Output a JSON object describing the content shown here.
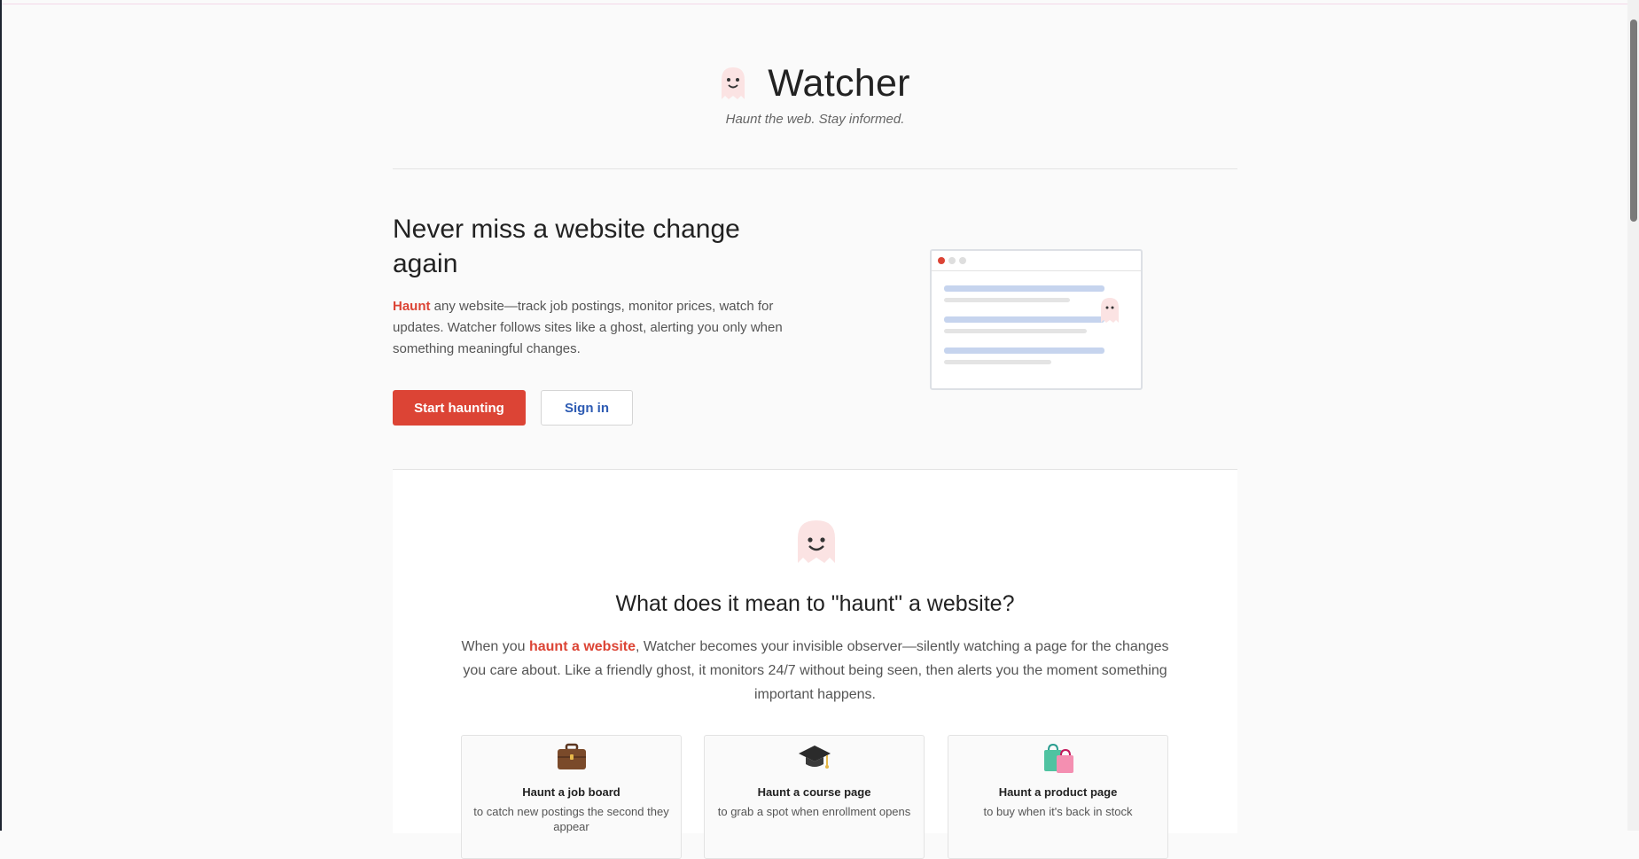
{
  "header": {
    "brand_name": "Watcher",
    "tagline": "Haunt the web. Stay informed.",
    "logo_icon": "ghost-icon"
  },
  "hero": {
    "title": "Never miss a website change again",
    "desc_accent": "Haunt",
    "desc_rest": " any website—track job postings, monitor prices, watch for updates. Watcher follows sites like a ghost, alerting you only when something meaningful changes.",
    "primary_button": "Start haunting",
    "secondary_button": "Sign in",
    "illustration_icon": "browser-window-with-ghost"
  },
  "explainer": {
    "icon": "ghost-icon",
    "title": "What does it mean to \"haunt\" a website?",
    "text_before": "When you ",
    "text_accent": "haunt a website",
    "text_after": ", Watcher becomes your invisible observer—silently watching a page for the changes you care about. Like a friendly ghost, it monitors 24/7 without being seen, then alerts you the moment something important happens.",
    "cards": [
      {
        "icon": "briefcase-icon",
        "glyph": "💼",
        "title": "Haunt a job board",
        "desc": "to catch new postings the second they appear"
      },
      {
        "icon": "graduation-cap-icon",
        "glyph": "🎓",
        "title": "Haunt a course page",
        "desc": "to grab a spot when enrollment opens"
      },
      {
        "icon": "shopping-bags-icon",
        "glyph": "🛍️",
        "title": "Haunt a product page",
        "desc": "to buy when it's back in stock"
      }
    ]
  },
  "colors": {
    "accent": "#dc4435",
    "link_blue": "#2d5bb3",
    "ghost": "#fbe3e3"
  }
}
